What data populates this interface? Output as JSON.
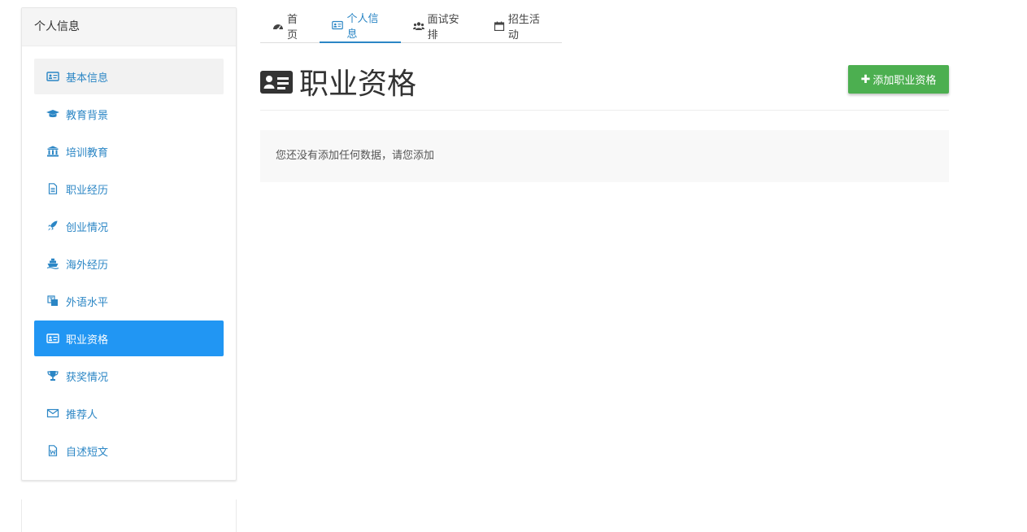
{
  "sidebar": {
    "header": "个人信息",
    "items": [
      {
        "label": "基本信息",
        "icon": "id-card-icon",
        "state": "hover"
      },
      {
        "label": "教育背景",
        "icon": "graduation-cap-icon",
        "state": ""
      },
      {
        "label": "培训教育",
        "icon": "institution-icon",
        "state": ""
      },
      {
        "label": "职业经历",
        "icon": "file-text-icon",
        "state": ""
      },
      {
        "label": "创业情况",
        "icon": "rocket-icon",
        "state": ""
      },
      {
        "label": "海外经历",
        "icon": "ship-icon",
        "state": ""
      },
      {
        "label": "外语水平",
        "icon": "language-icon",
        "state": ""
      },
      {
        "label": "职业资格",
        "icon": "id-card-icon",
        "state": "active"
      },
      {
        "label": "获奖情况",
        "icon": "trophy-icon",
        "state": ""
      },
      {
        "label": "推荐人",
        "icon": "envelope-icon",
        "state": ""
      },
      {
        "label": "自述短文",
        "icon": "file-word-icon",
        "state": ""
      }
    ]
  },
  "tabs": [
    {
      "label": "首页",
      "icon": "dashboard-icon"
    },
    {
      "label": "个人信息",
      "icon": "id-card-icon"
    },
    {
      "label": "面试安排",
      "icon": "users-icon"
    },
    {
      "label": "招生活动",
      "icon": "calendar-icon"
    }
  ],
  "main": {
    "title": "职业资格",
    "add_button": "添加职业资格",
    "empty_message": "您还没有添加任何数据，请您添加"
  },
  "colors": {
    "accent": "#2196f3",
    "link": "#2b86c5",
    "success": "#4caf50"
  }
}
